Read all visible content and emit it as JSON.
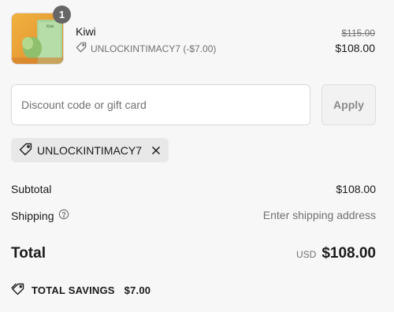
{
  "line_item": {
    "quantity": "1",
    "name": "Kiwi",
    "discount_label": "UNLOCKINTIMACY7 (-$7.00)",
    "original_price": "$115.00",
    "price": "$108.00",
    "thumbnail_text": "Kiwi"
  },
  "discount": {
    "placeholder": "Discount code or gift card",
    "apply_label": "Apply",
    "applied_code": "UNLOCKINTIMACY7"
  },
  "summary": {
    "subtotal_label": "Subtotal",
    "subtotal_value": "$108.00",
    "shipping_label": "Shipping",
    "shipping_value": "Enter shipping address",
    "total_label": "Total",
    "currency": "USD",
    "total_value": "$108.00",
    "savings_label": "TOTAL SAVINGS",
    "savings_value": "$7.00"
  },
  "icons": {
    "tag": "tag-icon",
    "close": "close-icon",
    "help": "help-circle-icon",
    "savings": "price-tag-icon"
  }
}
